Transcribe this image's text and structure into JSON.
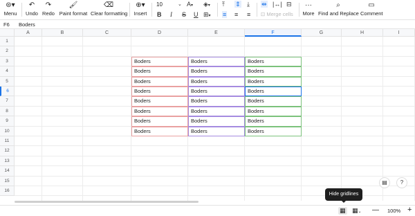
{
  "toolbar": {
    "menu": {
      "label": "Menu",
      "icon": "menu-icon"
    },
    "undo": {
      "label": "Undo",
      "icon": "undo-icon"
    },
    "redo": {
      "label": "Redo",
      "icon": "redo-icon"
    },
    "paint_format": {
      "label": "Paint format",
      "icon": "paint-format-icon"
    },
    "clear_formatting": {
      "label": "Clear formatting",
      "icon": "eraser-icon"
    },
    "insert": {
      "label": "Insert",
      "icon": "plus-circle-icon"
    },
    "font_size": "10",
    "merge_cells": {
      "label": "Merge cells",
      "icon": "merge-cells-icon"
    },
    "more": {
      "label": "More",
      "icon": "more-icon"
    },
    "find_replace": {
      "label": "Find and Replace",
      "icon": "find-replace-icon"
    },
    "comment": {
      "label": "Comment",
      "icon": "comment-icon"
    }
  },
  "formula_bar": {
    "cell_ref": "F6",
    "value": "Boders"
  },
  "columns": [
    "A",
    "B",
    "C",
    "D",
    "E",
    "F",
    "G",
    "H",
    "I"
  ],
  "selected_column": "F",
  "rows": [
    "1",
    "2",
    "3",
    "4",
    "5",
    "6",
    "7",
    "8",
    "9",
    "10",
    "11",
    "12",
    "13",
    "14",
    "15",
    "16"
  ],
  "selected_row": "6",
  "cells": {
    "D": [
      "Boders",
      "Boders",
      "Boders",
      "Boders",
      "Boders",
      "Boders",
      "Boders",
      "Boders"
    ],
    "E": [
      "Boders",
      "Boders",
      "Boders",
      "Boders",
      "Boders",
      "Boders",
      "Boders",
      "Boders"
    ],
    "F": [
      "Boders",
      "Boders",
      "Boders",
      "Boders",
      "Boders",
      "Boders",
      "Boders",
      "Boders"
    ]
  },
  "border_colors": {
    "D": "#e9a1a1",
    "E": "#a58be0",
    "F": "#7cc27c"
  },
  "accent_color": "#1a73e8",
  "tooltip": "Hide gridlines",
  "zoom": "100%"
}
